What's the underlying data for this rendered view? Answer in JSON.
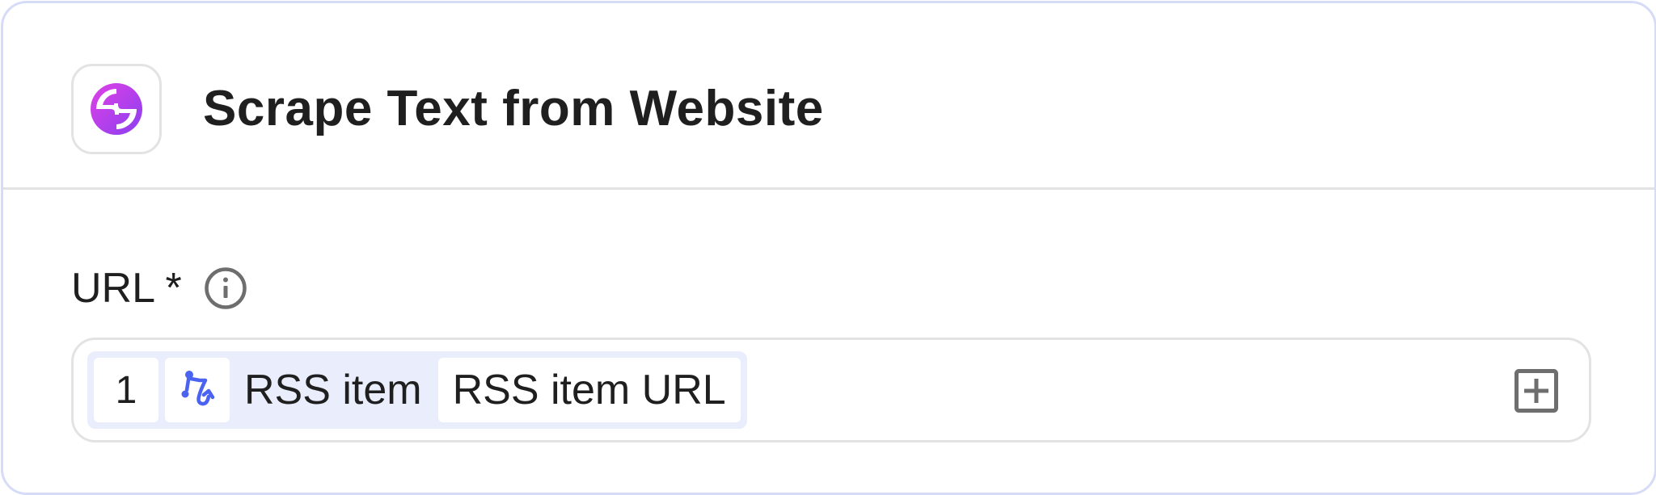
{
  "step": {
    "title": "Scrape Text from Website",
    "icon": "scraper-app-icon",
    "icon_gradient": [
      "#d63fe8",
      "#8a3ff0"
    ]
  },
  "field": {
    "label": "URL *",
    "info_icon": "info-icon",
    "value_tokens": {
      "step_number": "1",
      "source_icon": "rss-path-icon",
      "source_label": "RSS item",
      "field_label": "RSS item URL"
    },
    "add_icon": "plus-square-icon"
  },
  "colors": {
    "card_border": "#d6dcf7",
    "token_bg": "#e9edfc",
    "accent_blue": "#4a63f0",
    "divider": "#e3e3e3",
    "icon_grey": "#6e6e6e"
  }
}
